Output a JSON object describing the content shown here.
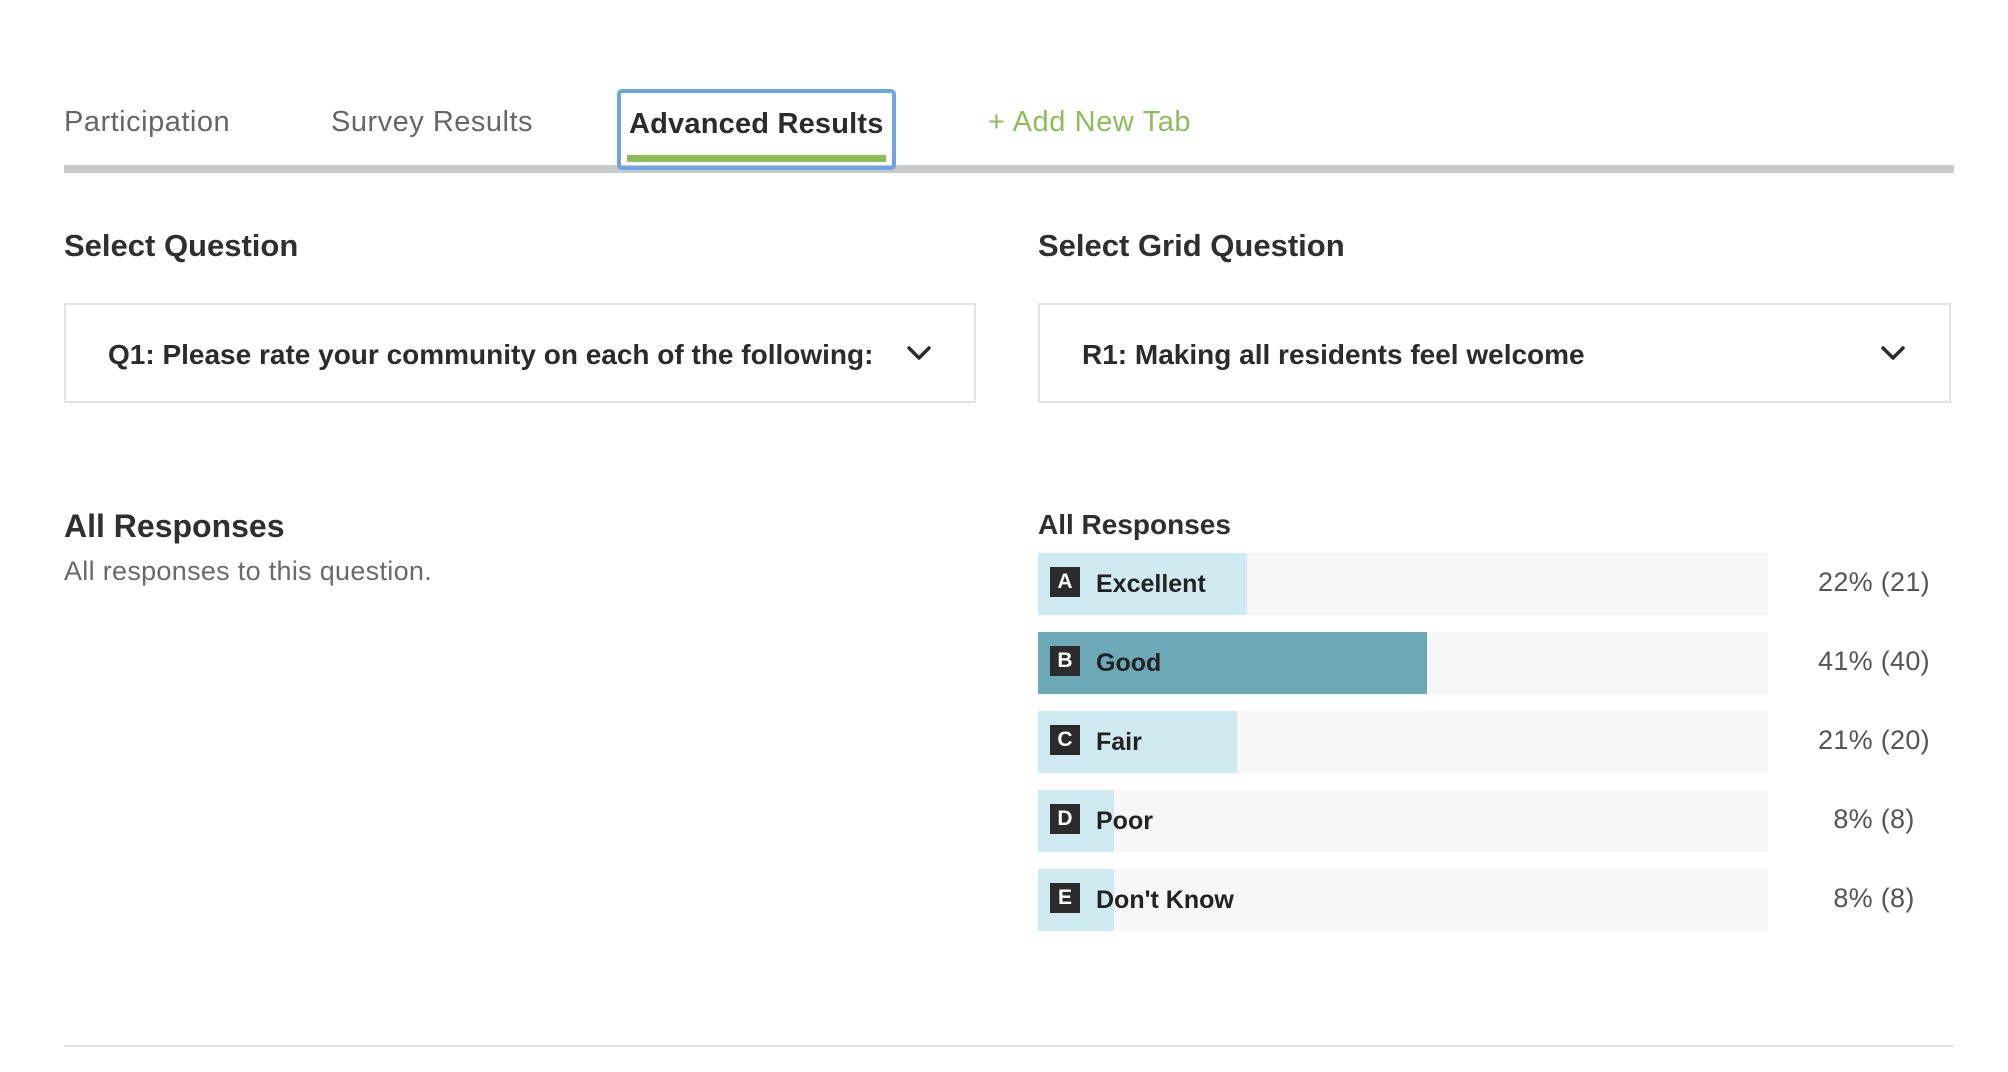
{
  "tabs": {
    "participation": "Participation",
    "survey_results": "Survey Results",
    "advanced_results": "Advanced Results",
    "add_new_tab": "+ Add New Tab"
  },
  "question_select": {
    "heading": "Select Question",
    "value": "Q1: Please rate your community on each of the following:"
  },
  "grid_select": {
    "heading": "Select Grid Question",
    "value": "R1: Making all residents feel welcome"
  },
  "left_panel": {
    "title": "All Responses",
    "subtitle": "All responses to this question."
  },
  "chart_data": {
    "type": "bar",
    "title": "All Responses",
    "categories": [
      "Excellent",
      "Good",
      "Fair",
      "Poor",
      "Don't Know"
    ],
    "letters": [
      "A",
      "B",
      "C",
      "D",
      "E"
    ],
    "percent": [
      22,
      41,
      21,
      8,
      8
    ],
    "counts": [
      21,
      40,
      20,
      8,
      8
    ],
    "labels": [
      "22% (21)",
      "41% (40)",
      "21% (20)",
      "8% (8)",
      "8% (8)"
    ],
    "highlighted_index": 1,
    "ylim": [
      0,
      100
    ]
  },
  "colors": {
    "accent_green": "#8cbd58",
    "focus_blue": "#6ea3e6",
    "bar_light": "#cfeaf0",
    "bar_highlight": "#6ca8b6",
    "track": "#f7f7f7"
  }
}
